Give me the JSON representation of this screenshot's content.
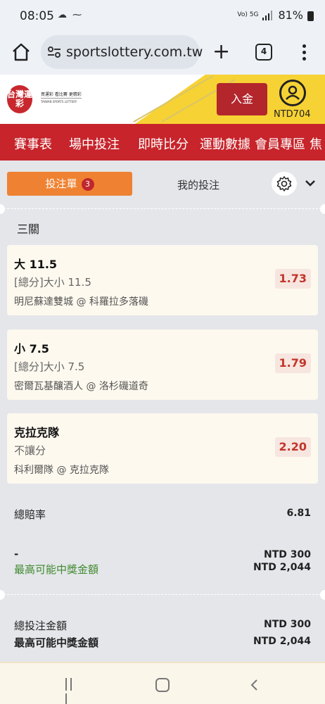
{
  "status_bar": {
    "time": "08:05",
    "left_icons": "☁ ⁓",
    "network": "Vo) 5G",
    "battery": "81%"
  },
  "browser": {
    "url_main": "sportslottery.com.tw",
    "tab_count": "4"
  },
  "site_header": {
    "logo_badge": "台灣運彩",
    "logo_line1": "買運彩 看比賽 更精彩",
    "logo_line2": "TAIWAN SPORTS LOTTERY",
    "deposit_label": "入金",
    "balance": "NTD704"
  },
  "nav": {
    "items": [
      "賽事表",
      "場中投注",
      "即時比分",
      "運動數據",
      "會員專區",
      "焦"
    ]
  },
  "betslip": {
    "tab_active": "投注單",
    "tab_active_count": "3",
    "tab_mybets": "我的投注",
    "bet_type": "三關",
    "selections": [
      {
        "pick": "大 11.5",
        "market": "[總分]大小 11.5",
        "match": "明尼蘇達雙城 @ 科羅拉多落磯",
        "odds": "1.73"
      },
      {
        "pick": "小 7.5",
        "market": "[總分]大小 7.5",
        "match": "密爾瓦基釀酒人 @ 洛杉磯道奇",
        "odds": "1.79"
      },
      {
        "pick": "克拉克隊",
        "market": "不讓分",
        "match": "科利爾隊 @ 克拉克隊",
        "odds": "2.20"
      }
    ],
    "total_odds_label": "總賠率",
    "total_odds_value": "6.81",
    "stake_dash": "-",
    "stake_value": "NTD 300",
    "max_win_label": "最高可能中獎金額",
    "max_win_value": "NTD 2,044",
    "total_stake_label": "總投注金額",
    "total_stake_value": "NTD 300",
    "max_win_label2": "最高可能中獎金額",
    "max_win_value2": "NTD 2,044"
  },
  "colors": {
    "brand_red": "#c7242b",
    "tab_orange": "#ef8232",
    "header_yellow": "#f7d234",
    "odds_red": "#c2352b",
    "green_text": "#3f8a2e"
  }
}
